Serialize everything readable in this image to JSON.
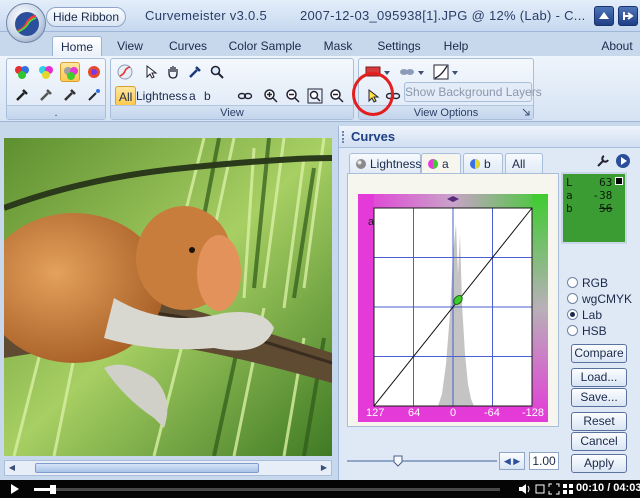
{
  "window": {
    "hide_ribbon_label": "Hide Ribbon",
    "app_title": "Curvemeister v3.0.5",
    "document_title": "2007-12-03_095938[1].JPG @ 12% (Lab) - C..."
  },
  "tabs": [
    {
      "label": "Home",
      "active": true
    },
    {
      "label": "View",
      "active": false
    },
    {
      "label": "Curves",
      "active": false
    },
    {
      "label": "Color Sample",
      "active": false
    },
    {
      "label": "Mask",
      "active": false
    },
    {
      "label": "Settings",
      "active": false
    },
    {
      "label": "Help",
      "active": false
    },
    {
      "label": "About",
      "active": false
    }
  ],
  "ribbon": {
    "group_tools_label": ".",
    "group_view_label": "View",
    "group_view_options_label": "View Options",
    "channels": {
      "all": "All",
      "lightness": "Lightness",
      "a": "a",
      "b": "b"
    },
    "show_background_layers": "Show Background Layers"
  },
  "curves": {
    "title": "Curves",
    "tabs": [
      {
        "label": "Lightness",
        "active": false
      },
      {
        "label": "a",
        "active": true
      },
      {
        "label": "b",
        "active": false
      },
      {
        "label": "All",
        "active": false
      }
    ],
    "graph_channel": "a",
    "axis_labels": [
      "127",
      "64",
      "0",
      "-64",
      "-128"
    ],
    "readout": {
      "L": "63",
      "a": "-38",
      "b": "56"
    },
    "color_modes": [
      {
        "label": "RGB",
        "selected": false
      },
      {
        "label": "wgCMYK",
        "selected": false
      },
      {
        "label": "Lab",
        "selected": true
      },
      {
        "label": "HSB",
        "selected": false
      }
    ],
    "buttons": {
      "compare": "Compare",
      "load": "Load...",
      "save": "Save...",
      "reset": "Reset",
      "cancel": "Cancel",
      "apply": "Apply"
    },
    "zoom_value": "1.00"
  },
  "player": {
    "progress": 0.04,
    "time": "00:10 / 04:03"
  },
  "colors": {
    "accent_magenta": "#e43ad8",
    "accent_green": "#3ecc2f",
    "readout_green": "#3c9c34",
    "annotation_red": "#e21e1e"
  }
}
